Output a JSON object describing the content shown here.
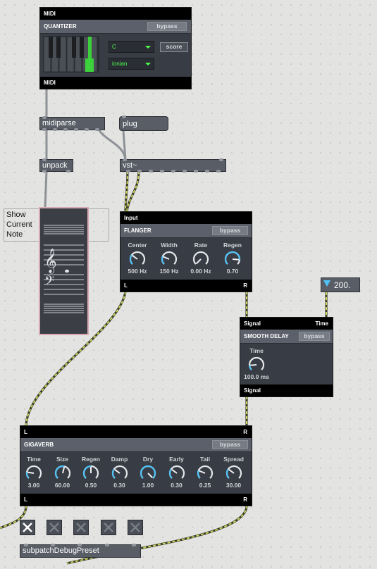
{
  "quantizer": {
    "in_label": "MIDI",
    "title": "QUANTIZER",
    "bypass_label": "bypass",
    "key_value": "C",
    "scale_value": "ionian",
    "score_label": "score",
    "out_label": "MIDI"
  },
  "objects": {
    "midiparse": "midiparse",
    "plug": "plug",
    "unpack": "unpack",
    "vst": "vst~",
    "subpatch": "subpatchDebugPreset"
  },
  "comment": {
    "line1": "Show",
    "line2": "Current",
    "line3": "Note"
  },
  "flanger": {
    "in_label": "Input",
    "title": "FLANGER",
    "bypass_label": "bypass",
    "out_left": "L",
    "out_right": "R",
    "dials": [
      {
        "name": "Center",
        "value": "500 Hz",
        "level": 0.3
      },
      {
        "name": "Width",
        "value": "150 Hz",
        "level": 0.25
      },
      {
        "name": "Rate",
        "value": "0.00 Hz",
        "level": 0.0
      },
      {
        "name": "Regen",
        "value": "0.70",
        "level": 0.85
      }
    ]
  },
  "number_box": {
    "value": "200."
  },
  "smooth_delay": {
    "in_left": "Signal",
    "in_right": "Time",
    "title": "SMOOTH DELAY",
    "bypass_label": "bypass",
    "dial": {
      "name": "Time",
      "value": "100.0 ms",
      "level": 0.15
    },
    "out_label": "Signal"
  },
  "gigaverb": {
    "in_left": "L",
    "in_right": "R",
    "title": "GIGAVERB",
    "bypass_label": "bypass",
    "out_left": "L",
    "out_right": "R",
    "dials": [
      {
        "name": "Time",
        "value": "3.00",
        "level": 0.2
      },
      {
        "name": "Size",
        "value": "60.00",
        "level": 0.55
      },
      {
        "name": "Regen",
        "value": "0.50",
        "level": 0.5
      },
      {
        "name": "Damp",
        "value": "0.30",
        "level": 0.3
      },
      {
        "name": "Dry",
        "value": "1.00",
        "level": 1.0
      },
      {
        "name": "Early",
        "value": "0.30",
        "level": 0.3
      },
      {
        "name": "Tail",
        "value": "0.25",
        "level": 0.25
      },
      {
        "name": "Spread",
        "value": "30.00",
        "level": 0.3
      }
    ]
  },
  "colors": {
    "accent": "#4fc3f7",
    "midi_green": "#4cff4c",
    "panel": "#383c44",
    "header": "#5c606a"
  }
}
